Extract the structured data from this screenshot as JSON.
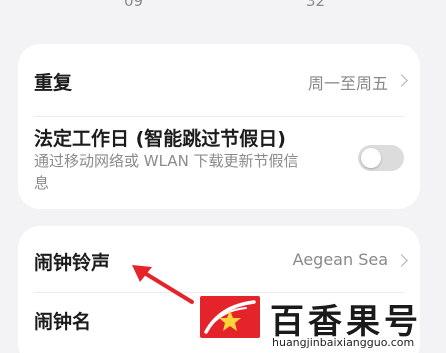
{
  "time_peek": {
    "left": "09",
    "right": "32"
  },
  "settings": {
    "repeat": {
      "label": "重复",
      "value": "周一至周五"
    },
    "holiday": {
      "label": "法定工作日 (智能跳过节假日)",
      "desc_line1": "通过移动网络或 WLAN 下载更新节假信",
      "desc_line2": "息",
      "enabled": false
    },
    "ringtone": {
      "label": "闹钟铃声",
      "value": "Aegean Sea"
    },
    "alarm_name": {
      "label": "闹钟名"
    }
  },
  "watermark": {
    "brand": "百香果号",
    "url": "huangjinbaixiangguo.com"
  },
  "colors": {
    "accent_red": "#e4242a",
    "toggle_off": "#dcdcdc",
    "page_bg": "#f3f3f5"
  }
}
